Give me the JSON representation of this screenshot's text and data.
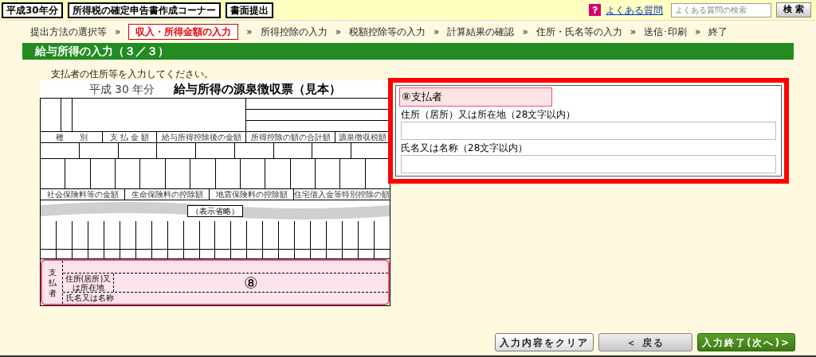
{
  "header": {
    "badges": [
      "平成30年分",
      "所得税の確定申告書作成コーナー",
      "書面提出"
    ],
    "help_link": "よくある質問",
    "search": {
      "placeholder": "よくある質問の検索",
      "button": "検 索"
    }
  },
  "steps": [
    {
      "label": "提出方法の選択等",
      "selected": false,
      "separator": "»"
    },
    {
      "label": "収入・所得金額の入力",
      "selected": true,
      "separator": "»"
    },
    {
      "label": "所得控除の入力",
      "selected": false,
      "separator": "»"
    },
    {
      "label": "税額控除等の入力",
      "selected": false,
      "separator": "»"
    },
    {
      "label": "計算結果の確認",
      "selected": false,
      "separator": "»"
    },
    {
      "label": "住所・氏名等の入力",
      "selected": false,
      "separator": "»"
    },
    {
      "label": "送信･印刷",
      "selected": false,
      "separator": "»"
    },
    {
      "label": "終了",
      "selected": false
    }
  ],
  "section_title": "給与所得の入力（３／３）",
  "instruction": "支払者の住所等を入力してください。",
  "slip": {
    "year": "平成 30 年分",
    "title": "給与所得の源泉徴収票（見本）",
    "amount_headers": [
      "種　　別",
      "支 払 金 額",
      "給与所得控除後の金額",
      "所得控除の額の合計額",
      "源泉徴収税額"
    ],
    "deduction_headers": [
      "社会保険料等の金額",
      "生命保険料の控除額",
      "地震保険料の控除額",
      "住宅借入金等特別控除の額"
    ],
    "omitted": "（表示省略）",
    "payer": {
      "label": "支払者",
      "address_label": "住所(居所)又は所在地",
      "name_label": "氏名又は名称",
      "marker": "⑧"
    }
  },
  "panel": {
    "heading": "⑧支払者",
    "fields": [
      {
        "label": "住所（居所）又は所在地（28文字以内）"
      },
      {
        "label": "氏名又は名称（28文字以内）"
      }
    ]
  },
  "buttons": [
    {
      "label": "入力内容をクリア",
      "kind": "plain"
    },
    {
      "label": "＜ 戻る",
      "kind": "back"
    },
    {
      "label": "入力終了(次へ)>",
      "kind": "next"
    }
  ]
}
